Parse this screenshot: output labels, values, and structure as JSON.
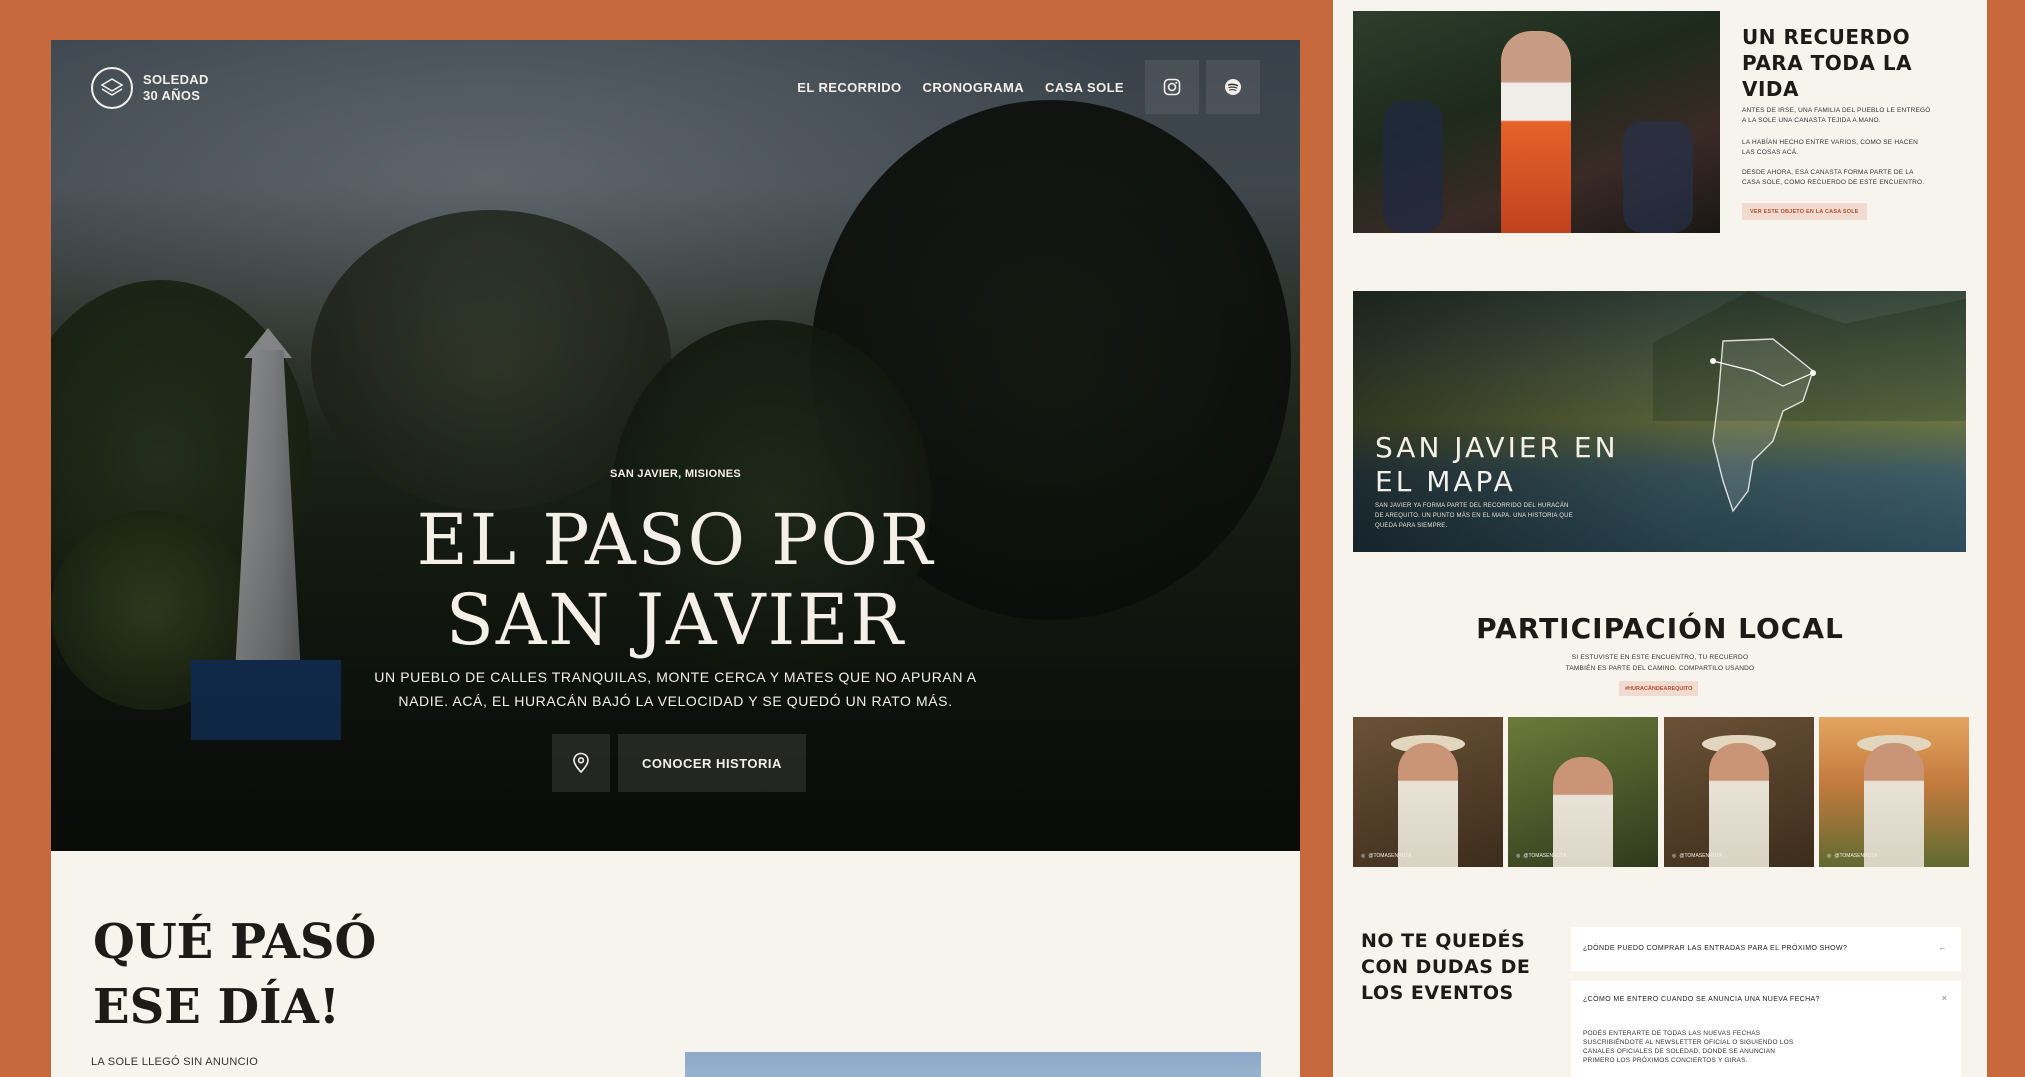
{
  "logo": {
    "line1": "SOLEDAD",
    "line2": "30 AÑOS"
  },
  "nav": {
    "items": [
      "EL RECORRIDO",
      "CRONOGRAMA",
      "CASA SOLE"
    ],
    "icons": [
      "instagram-icon",
      "spotify-icon"
    ]
  },
  "hero": {
    "kicker": "SAN JAVIER, MISIONES",
    "title_line1": "EL PASO POR",
    "title_line2": "SAN JAVIER",
    "sub_line1": "UN PUEBLO DE CALLES TRANQUILAS, MONTE CERCA Y MATES QUE NO APURAN A",
    "sub_line2": "NADIE. ACÁ, EL HURACÁN BAJÓ LA VELOCIDAD Y SE QUEDÓ UN RATO MÁS.",
    "cta_label": "CONOCER HISTORIA"
  },
  "que_paso": {
    "title_line1": "QUÉ PASÓ",
    "title_line2": "ESE DÍA!",
    "body": "LA SOLE LLEGÓ SIN ANUNCIO"
  },
  "recuerdo": {
    "title": "UN RECUERDO PARA TODA LA VIDA",
    "p1": "ANTES DE IRSE, UNA FAMILIA DEL PUEBLO LE ENTREGÓ A LA SOLE UNA CANASTA TEJIDA A MANO.",
    "p2": "LA HABÍAN HECHO ENTRE VARIOS, COMO SE HACEN LAS COSAS ACÁ.",
    "p3": "DESDE AHORA, ESA CANASTA FORMA PARTE DE LA CASA SOLE, COMO RECUERDO DE ESTE ENCUENTRO.",
    "button": "VER ESTE OBJETO EN LA CASA SOLE"
  },
  "mapa": {
    "title_line1": "SAN JAVIER EN",
    "title_line2": "EL MAPA",
    "desc": "SAN JAVIER YA FORMA PARTE DEL RECORRIDO DEL HURACÁN DE AREQUITO. UN PUNTO MÁS EN EL MAPA. UNA HISTORIA QUE QUEDA PARA SIEMPRE."
  },
  "participacion": {
    "title": "PARTICIPACIÓN LOCAL",
    "sub_line1": "SI ESTUVISTE EN ESTE ENCUENTRO, TU RECUERDO",
    "sub_line2": "TAMBIÉN ES PARTE DEL CAMINO. COMPARTILO USANDO",
    "tag": "#HURACÁNDEAREQUITO",
    "photos": [
      {
        "handle": "@TOMASENRUTA"
      },
      {
        "handle": "@TOMASENRUTA"
      },
      {
        "handle": "@TOMASENRUTA"
      },
      {
        "handle": "@TOMASENRUTA"
      }
    ]
  },
  "faq": {
    "title_line1": "NO TE QUEDÉS",
    "title_line2": "CON DUDAS DE",
    "title_line3": "LOS EVENTOS",
    "items": [
      {
        "q": "¿DÓNDE PUEDO COMPRAR LAS ENTRADAS PARA EL PRÓXIMO SHOW?",
        "icon": "←"
      },
      {
        "q": "¿CÓMO ME ENTERO CUANDO SE ANUNCIA UNA NUEVA FECHA?",
        "icon": "×",
        "a": "PODÉS ENTERARTE DE TODAS LAS NUEVAS FECHAS SUSCRIBIÉNDOTE AL NEWSLETTER OFICIAL O SIGUIENDO LOS CANALES OFICIALES DE SOLEDAD, DONDE SE ANUNCIAN PRIMERO LOS PRÓXIMOS CONCIERTOS Y GIRAS."
      }
    ]
  },
  "colors": {
    "frame": "#c8683d",
    "paper": "#f7f4ee",
    "accent_tag_bg": "#f1dbd0",
    "accent_tag_text": "#b24f2a"
  }
}
